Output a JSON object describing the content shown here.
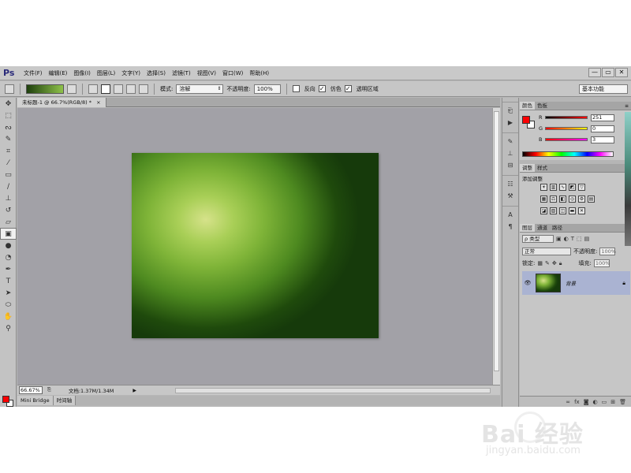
{
  "app": {
    "logo": "Ps",
    "menu": [
      "文件(F)",
      "编辑(E)",
      "图像(I)",
      "图层(L)",
      "文字(Y)",
      "选择(S)",
      "滤镜(T)",
      "视图(V)",
      "窗口(W)",
      "帮助(H)"
    ],
    "window_buttons": [
      "—",
      "▭",
      "✕"
    ]
  },
  "options": {
    "mode_label": "模式:",
    "mode_value": "溶解",
    "opacity_label": "不透明度:",
    "opacity_value": "100%",
    "reverse_label": "反向",
    "dither_label": "仿色",
    "transparency_label": "透明区域",
    "reverse_checked": false,
    "dither_checked": true,
    "transparency_checked": true,
    "workspace": "基本功能",
    "gradient_colors": [
      "#1e3f0d",
      "#8fc24b"
    ]
  },
  "document": {
    "tab_title": "未标题-1 @ 66.7%(RGB/8) *",
    "close_icon": "×",
    "zoom": "66.67%",
    "doc_info": "文档:1.37M/1.34M"
  },
  "bottom_tabs": [
    "Mini Bridge",
    "时间轴"
  ],
  "color_panel": {
    "tabs": [
      "颜色",
      "色板"
    ],
    "r_label": "R",
    "r_value": "251",
    "g_label": "G",
    "g_value": "0",
    "b_label": "B",
    "b_value": "3",
    "foreground": "#fb0003",
    "background": "#ffffff"
  },
  "adjust_panel": {
    "tabs": [
      "调整",
      "样式"
    ],
    "title": "添加调整"
  },
  "layers_panel": {
    "tabs": [
      "图层",
      "通道",
      "路径"
    ],
    "filter": "ρ 类型",
    "blend_mode": "正常",
    "opacity_label": "不透明度:",
    "opacity_value": "100%",
    "lock_label": "锁定:",
    "fill_label": "填充:",
    "fill_value": "100%",
    "layer_name": "背景"
  },
  "watermark": {
    "logo": "Bai 经验",
    "url": "jingyan.baidu.com"
  }
}
